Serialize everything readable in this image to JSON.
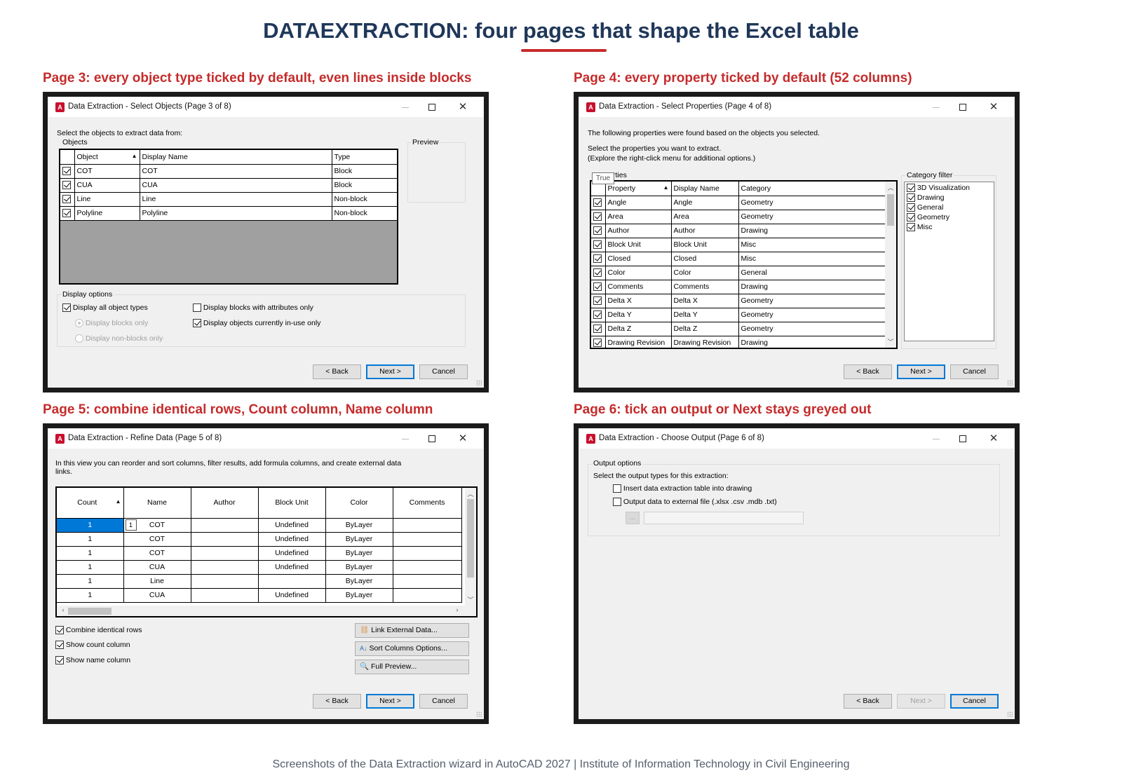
{
  "title": "DATAEXTRACTION: four pages that shape the Excel table",
  "footer": "Screenshots of the Data Extraction wizard in AutoCAD 2027 | Institute of Information Technology in Civil Engineering",
  "app_icon": "A",
  "accent_color": "#c62b2b",
  "window_controls": {
    "minimize": "—",
    "maximize": "☐",
    "close": "✕"
  },
  "buttons": {
    "back": "< Back",
    "next": "Next >",
    "cancel": "Cancel"
  },
  "page3": {
    "caption": "Page 3: every object type ticked by default, even lines inside blocks",
    "window_title": "Data Extraction - Select Objects (Page 3 of 8)",
    "instruction": "Select the objects to extract data from:",
    "objects_label": "Objects",
    "preview_label": "Preview",
    "columns": [
      "Object",
      "Display Name",
      "Type"
    ],
    "rows": [
      {
        "checked": true,
        "object": "COT",
        "display": "COT",
        "type": "Block"
      },
      {
        "checked": true,
        "object": "CUA",
        "display": "CUA",
        "type": "Block"
      },
      {
        "checked": true,
        "object": "Line",
        "display": "Line",
        "type": "Non-block"
      },
      {
        "checked": true,
        "object": "Polyline",
        "display": "Polyline",
        "type": "Non-block"
      }
    ],
    "display_options_label": "Display options",
    "opt_all_types": "Display all object types",
    "opt_blocks_only": "Display blocks only",
    "opt_nonblocks_only": "Display non-blocks only",
    "opt_blocks_attr": "Display blocks with attributes only",
    "opt_in_use": "Display objects currently in-use only"
  },
  "page4": {
    "caption": "Page 4: every property ticked by default (52 columns)",
    "window_title": "Data Extraction - Select Properties (Page 4 of 8)",
    "line1": "The following properties were found based on the objects you selected.",
    "line2": "Select the properties you want to extract.",
    "line3": "(Explore the right-click menu for additional options.)",
    "properties_label": "Properties",
    "tooltip": "True",
    "columns": [
      "Property",
      "Display Name",
      "Category"
    ],
    "rows": [
      {
        "property": "Angle",
        "display": "Angle",
        "category": "Geometry"
      },
      {
        "property": "Area",
        "display": "Area",
        "category": "Geometry"
      },
      {
        "property": "Author",
        "display": "Author",
        "category": "Drawing"
      },
      {
        "property": "Block Unit",
        "display": "Block Unit",
        "category": "Misc"
      },
      {
        "property": "Closed",
        "display": "Closed",
        "category": "Misc"
      },
      {
        "property": "Color",
        "display": "Color",
        "category": "General"
      },
      {
        "property": "Comments",
        "display": "Comments",
        "category": "Drawing"
      },
      {
        "property": "Delta X",
        "display": "Delta X",
        "category": "Geometry"
      },
      {
        "property": "Delta Y",
        "display": "Delta Y",
        "category": "Geometry"
      },
      {
        "property": "Delta Z",
        "display": "Delta Z",
        "category": "Geometry"
      },
      {
        "property": "Drawing Revision",
        "display": "Drawing Revision",
        "category": "Drawing"
      }
    ],
    "category_filter_label": "Category filter",
    "categories": [
      "3D Visualization",
      "Drawing",
      "General",
      "Geometry",
      "Misc"
    ]
  },
  "page5": {
    "caption": "Page 5: combine identical rows, Count column, Name column",
    "window_title": "Data Extraction - Refine Data (Page 5 of 8)",
    "line1": "In this view you can reorder and sort columns, filter results, add formula columns, and create external data",
    "line2": "links.",
    "columns": [
      "Count",
      "Name",
      "Author",
      "Block Unit",
      "Color",
      "Comments"
    ],
    "rows": [
      {
        "count": "1",
        "name": "COT",
        "author": "",
        "unit": "Undefined",
        "color": "ByLayer",
        "comments": ""
      },
      {
        "count": "1",
        "name": "COT",
        "author": "",
        "unit": "Undefined",
        "color": "ByLayer",
        "comments": ""
      },
      {
        "count": "1",
        "name": "COT",
        "author": "",
        "unit": "Undefined",
        "color": "ByLayer",
        "comments": ""
      },
      {
        "count": "1",
        "name": "CUA",
        "author": "",
        "unit": "Undefined",
        "color": "ByLayer",
        "comments": ""
      },
      {
        "count": "1",
        "name": "Line",
        "author": "",
        "unit": "",
        "color": "ByLayer",
        "comments": ""
      },
      {
        "count": "1",
        "name": "CUA",
        "author": "",
        "unit": "Undefined",
        "color": "ByLayer",
        "comments": ""
      }
    ],
    "cell_tooltip": "1",
    "combine_rows": "Combine identical rows",
    "show_count": "Show count column",
    "show_name": "Show name column",
    "link_external": "Link External Data...",
    "sort_columns": "Sort Columns Options...",
    "full_preview": "Full Preview..."
  },
  "page6": {
    "caption": "Page 6: tick an output or Next stays greyed out",
    "window_title": "Data Extraction - Choose Output (Page 6 of 8)",
    "output_options_label": "Output options",
    "instruction": "Select the output types for this extraction:",
    "insert_table": "Insert data extraction table into drawing",
    "output_external": "Output data to external file (.xlsx .csv .mdb .txt)",
    "browse": "..."
  }
}
